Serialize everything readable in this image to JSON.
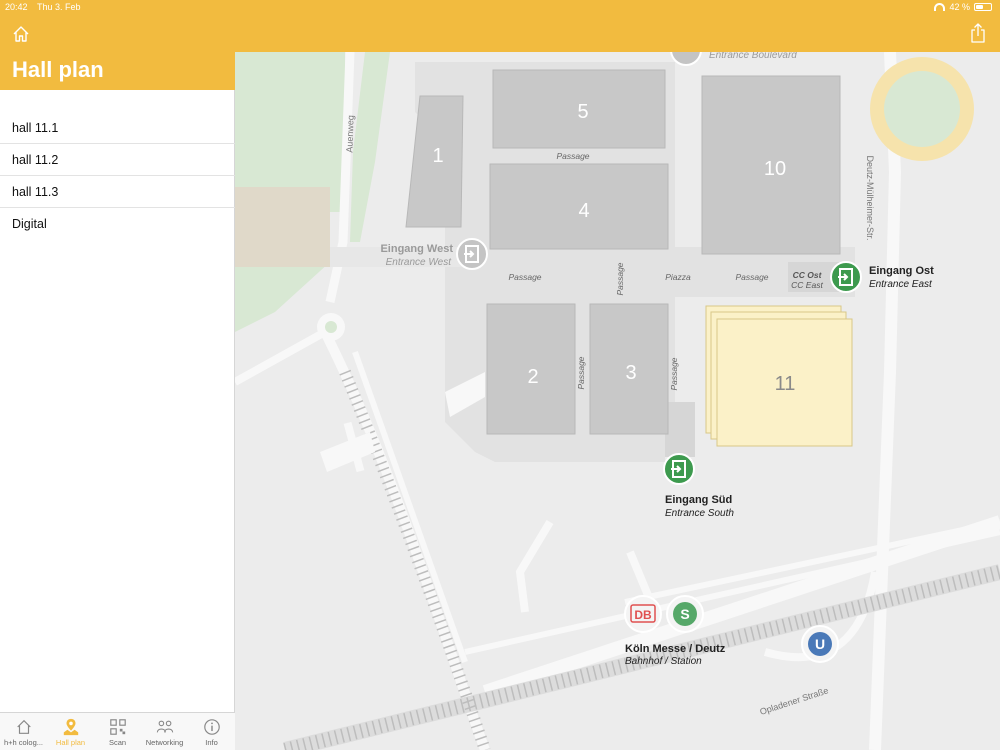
{
  "status": {
    "time": "20:42",
    "date": "Thu 3. Feb",
    "battery": "42 %",
    "battery_level": 0.42
  },
  "sidebar": {
    "title": "Hall plan",
    "items": [
      {
        "label": "hall 11.1"
      },
      {
        "label": "hall 11.2"
      },
      {
        "label": "hall 11.3"
      },
      {
        "label": "Digital"
      }
    ]
  },
  "tabbar": {
    "tabs": [
      {
        "label": "h+h colog...",
        "icon": "home-icon"
      },
      {
        "label": "Hall plan",
        "icon": "map-pin-icon",
        "active": true
      },
      {
        "label": "Scan",
        "icon": "qr-code-icon"
      },
      {
        "label": "Networking",
        "icon": "people-icon"
      },
      {
        "label": "Info",
        "icon": "info-icon"
      }
    ]
  },
  "colors": {
    "accent": "#f2bb3f",
    "hall_highlight": "#fbf1c8",
    "entrance_green": "#3d9a4e",
    "building_gray": "#c8c8c8"
  },
  "map": {
    "halls": [
      {
        "label": "1"
      },
      {
        "label": "2"
      },
      {
        "label": "3"
      },
      {
        "label": "4"
      },
      {
        "label": "5"
      },
      {
        "label": "10"
      },
      {
        "label": "11"
      }
    ],
    "passage": "Passage",
    "piazza": "Piazza",
    "cc_east_de": "CC Ost",
    "cc_east_en": "CC East",
    "entrances": {
      "boulevard_en": "Entrance Boulevard",
      "west_de": "Eingang West",
      "west_en": "Entrance West",
      "east_de": "Eingang Ost",
      "east_en": "Entrance East",
      "south_de": "Eingang Süd",
      "south_en": "Entrance South"
    },
    "station_de": "Köln Messe / Deutz",
    "station_en": "Bahnhof / Station",
    "db_label": "DB",
    "sbahn_label": "S",
    "ubahn_label": "U",
    "streets": {
      "auenweg": "Auenweg",
      "deutz": "Deutz-Mülheimer-Str.",
      "opladener": "Opladener Straße"
    }
  }
}
